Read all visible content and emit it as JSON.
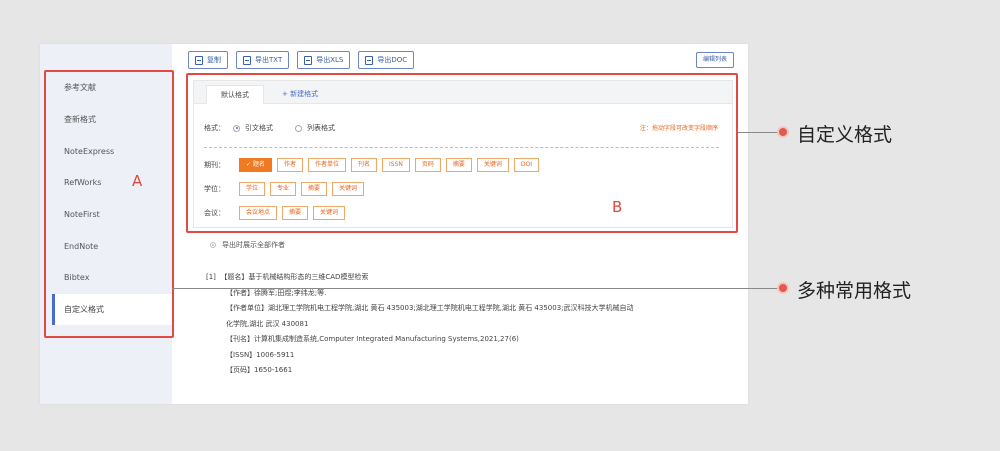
{
  "sidebar": {
    "items": [
      {
        "label": "参考文献"
      },
      {
        "label": "查新格式"
      },
      {
        "label": "NoteExpress"
      },
      {
        "label": "RefWorks"
      },
      {
        "label": "NoteFirst"
      },
      {
        "label": "EndNote"
      },
      {
        "label": "Bibtex"
      },
      {
        "label": "自定义格式"
      }
    ],
    "annotation_label": "A"
  },
  "toolbar": {
    "copy": "复制",
    "export_txt": "导出TXT",
    "export_xls": "导出XLS",
    "export_doc": "导出DOC",
    "edit_list": "编辑列表"
  },
  "panel": {
    "tab_default": "默认格式",
    "tab_new": "+ 新建格式",
    "format_label": "格式：",
    "format_options": [
      "引文格式",
      "列表格式"
    ],
    "note": "注：拖动字段可改变字段顺序",
    "annotation_label": "B",
    "rows": [
      {
        "label": "期刊：",
        "tags": [
          "✓ 题名",
          "作者",
          "作者单位",
          "刊名",
          "ISSN",
          "页码",
          "摘要",
          "关键词",
          "DOI"
        ]
      },
      {
        "label": "学位：",
        "tags": [
          "学位",
          "专业",
          "摘要",
          "关键词"
        ]
      },
      {
        "label": "会议：",
        "tags": [
          "会议地点",
          "摘要",
          "关键词"
        ]
      }
    ]
  },
  "export_option": "导出时展示全部作者",
  "reference": {
    "index": "[1]",
    "title_line": "【题名】基于机械结构形态的三维CAD模型检索",
    "authors": "【作者】徐腾军;田煜;李纬龙;等.",
    "affiliation_1": "【作者单位】湖北理工学院机电工程学院,湖北 黄石 435003;湖北理工学院机电工程学院,湖北 黄石 435003;武汉科技大学机械自动",
    "affiliation_2": "化学院,湖北 武汉 430081",
    "journal": "【刊名】计算机集成制造系统,Computer Integrated Manufacturing Systems,2021,27(6)",
    "issn": "【ISSN】1006-5911",
    "pages": "【页码】1650-1661"
  },
  "callouts": {
    "custom_format": "自定义格式",
    "common_formats": "多种常用格式"
  }
}
